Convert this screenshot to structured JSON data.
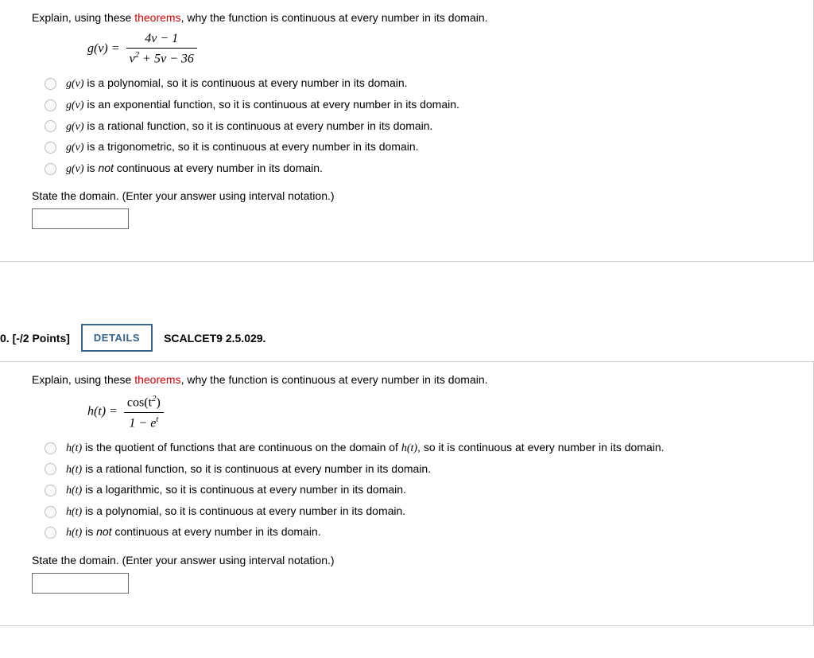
{
  "q1": {
    "prompt_before": "Explain, using these ",
    "theorems": "theorems",
    "prompt_after": ", why the function is continuous at every number in its domain.",
    "eq_lhs": "g(v) = ",
    "eq_num": "4v − 1",
    "eq_den_a": "v",
    "eq_den_sup": "2",
    "eq_den_b": " + 5v − 36",
    "options": [
      {
        "fn": "g(v)",
        "text": " is a polynomial, so it is continuous at every number in its domain."
      },
      {
        "fn": "g(v)",
        "text": " is an exponential function, so it is continuous at every number in its domain."
      },
      {
        "fn": "g(v)",
        "text": " is a rational function, so it is continuous at every number in its domain."
      },
      {
        "fn": "g(v)",
        "text": " is a trigonometric, so it is continuous at every number in its domain."
      },
      {
        "fn": "g(v)",
        "text_before": " is ",
        "not": "not",
        "text_after": " continuous at every number in its domain."
      }
    ],
    "state_prompt": "State the domain. (Enter your answer using interval notation.)"
  },
  "header": {
    "points": "0. [-/2 Points]",
    "details": "DETAILS",
    "ref": "SCALCET9 2.5.029."
  },
  "q2": {
    "prompt_before": "Explain, using these ",
    "theorems": "theorems",
    "prompt_after": ", why the function is continuous at every number in its domain.",
    "eq_lhs": "h(t) = ",
    "eq_num_a": "cos(t",
    "eq_num_sup": "2",
    "eq_num_b": ")",
    "eq_den_a": "1 − e",
    "eq_den_sup": "t",
    "options": [
      {
        "fn": "h(t)",
        "text_before": " is the quotient of functions that are continuous on the domain of ",
        "fn2": "h(t)",
        "text_after": ", so it is continuous at every number in its domain."
      },
      {
        "fn": "h(t)",
        "text": " is a rational function, so it is continuous at every number in its domain."
      },
      {
        "fn": "h(t)",
        "text": " is a logarithmic, so it is continuous at every number in its domain."
      },
      {
        "fn": "h(t)",
        "text": " is a polynomial, so it is continuous at every number in its domain."
      },
      {
        "fn": "h(t)",
        "text_before": " is ",
        "not": "not",
        "text_after": " continuous at every number in its domain."
      }
    ],
    "state_prompt": "State the domain. (Enter your answer using interval notation.)"
  }
}
